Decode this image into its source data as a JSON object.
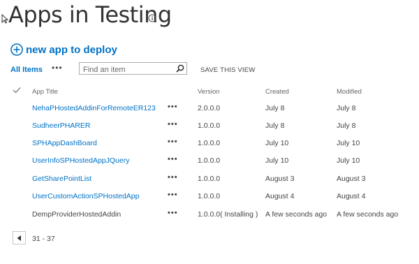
{
  "page": {
    "title": "Apps in Testing",
    "info_icon": "info-icon",
    "new_app_label": "new app to deploy",
    "new_app_icon": "plus-circle-icon",
    "accent_color": "#0072c6"
  },
  "toolbar": {
    "view_name": "All Items",
    "more_label": "•••",
    "search_placeholder": "Find an item",
    "search_icon": "search-icon",
    "save_view_label": "SAVE THIS VIEW"
  },
  "table": {
    "headers": {
      "select_icon": "checkmark-icon",
      "title": "App Title",
      "version": "Version",
      "created": "Created",
      "modified": "Modified"
    },
    "rows": [
      {
        "title": "NehaPHostedAddinForRemoteER123",
        "menu": "•••",
        "version": "2.0.0.0",
        "created": "July 8",
        "modified": "July 8",
        "is_link": true
      },
      {
        "title": "SudheerPHARER",
        "menu": "•••",
        "version": "1.0.0.0",
        "created": "July 8",
        "modified": "July 8",
        "is_link": true
      },
      {
        "title": "SPHAppDashBoard",
        "menu": "•••",
        "version": "1.0.0.0",
        "created": "July 10",
        "modified": "July 10",
        "is_link": true
      },
      {
        "title": "UserInfoSPHostedAppJQuery",
        "menu": "•••",
        "version": "1.0.0.0",
        "created": "July 10",
        "modified": "July 10",
        "is_link": true
      },
      {
        "title": "GetSharePointList",
        "menu": "•••",
        "version": "1.0.0.0",
        "created": "August 3",
        "modified": "August 3",
        "is_link": true
      },
      {
        "title": "UserCustomActionSPHostedApp",
        "menu": "•••",
        "version": "1.0.0.0",
        "created": "August 4",
        "modified": "August 4",
        "is_link": true
      },
      {
        "title": "DempProviderHostedAddin",
        "menu": "•••",
        "version": "1.0.0.0( Installing )",
        "created": "A few seconds ago",
        "modified": "A few seconds ago",
        "is_link": false
      }
    ]
  },
  "pager": {
    "prev_icon": "triangle-left-icon",
    "range": "31 - 37"
  }
}
